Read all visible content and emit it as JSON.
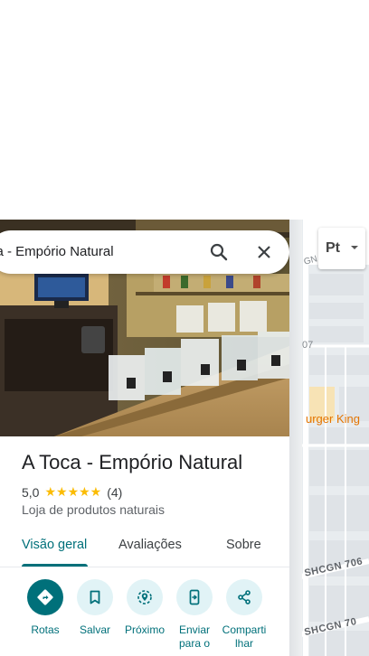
{
  "search": {
    "query": "ca - Empório Natural"
  },
  "place": {
    "name": "A Toca - Empório Natural",
    "rating": "5,0",
    "stars": "★★★★★",
    "review_count": "(4)",
    "category": "Loja de produtos naturais"
  },
  "tabs": [
    "Visão geral",
    "Avaliações",
    "Sobre"
  ],
  "actions": [
    {
      "label": "Rotas",
      "icon": "directions-icon"
    },
    {
      "label": "Salvar",
      "icon": "bookmark-icon"
    },
    {
      "label": "Próximo",
      "icon": "nearby-icon"
    },
    {
      "label": "Enviar para o",
      "icon": "send-to-phone-icon"
    },
    {
      "label": "Comparti lhar",
      "icon": "share-icon"
    }
  ],
  "map": {
    "layer_button": "Pt",
    "labels": {
      "gn": "GN",
      "n07": "07",
      "burger": "urger King",
      "street1": "SHCGN 706",
      "street2": "SHCGN 70"
    }
  },
  "colors": {
    "accent": "#00707a",
    "accent_light": "#e1f3f6",
    "star": "#fbbc04",
    "map_road": "#ffffff",
    "map_block": "#dfe3e7",
    "map_poi": "#f7e3b5",
    "burger_label": "#e37400"
  }
}
